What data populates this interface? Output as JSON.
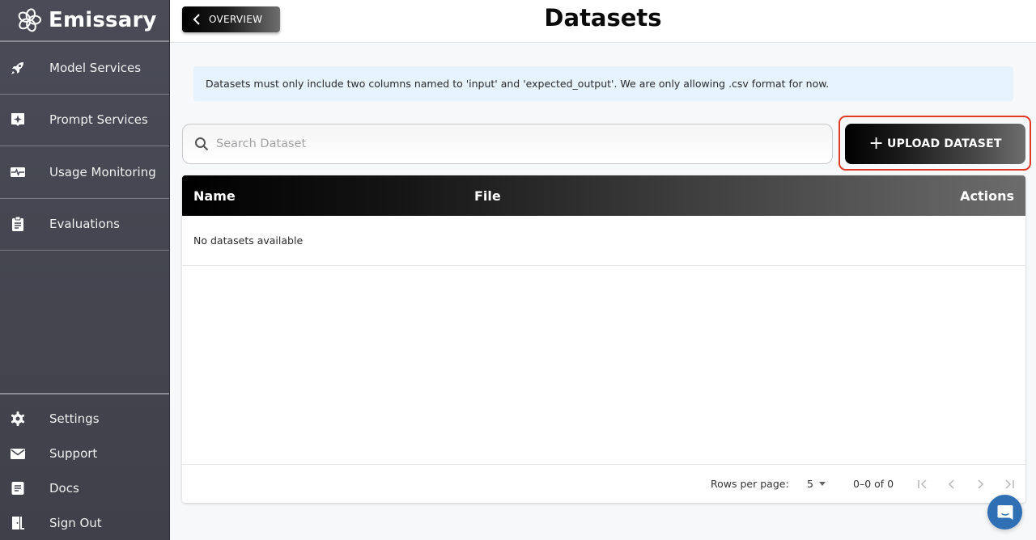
{
  "app": {
    "name": "Emissary"
  },
  "sidebar": {
    "items": [
      {
        "label": "Model Services",
        "icon": "rocket-icon"
      },
      {
        "label": "Prompt Services",
        "icon": "sparkle-chat-icon"
      },
      {
        "label": "Usage Monitoring",
        "icon": "pulse-monitor-icon"
      },
      {
        "label": "Evaluations",
        "icon": "clipboard-icon"
      }
    ],
    "bottom_items": [
      {
        "label": "Settings",
        "icon": "gear-icon"
      },
      {
        "label": "Support",
        "icon": "envelope-icon"
      },
      {
        "label": "Docs",
        "icon": "document-icon"
      },
      {
        "label": "Sign Out",
        "icon": "door-exit-icon"
      }
    ]
  },
  "header": {
    "back_label": "OVERVIEW",
    "title": "Datasets"
  },
  "info_banner": "Datasets must only include two columns named to 'input' and 'expected_output'. We are only allowing .csv format for now.",
  "search": {
    "placeholder": "Search Dataset",
    "value": ""
  },
  "upload_button": {
    "label": "UPLOAD DATASET",
    "icon": "plus-icon"
  },
  "table": {
    "columns": [
      "Name",
      "File",
      "Actions"
    ],
    "rows": [],
    "empty_message": "No datasets available",
    "footer": {
      "rows_per_page_label": "Rows per page:",
      "rows_per_page_value": "5",
      "range": "0–0 of 0"
    }
  },
  "colors": {
    "sidebar_bg": "#4a4b57",
    "info_bg": "#e6f3fc",
    "highlight_outline": "#e03a2a",
    "chat_bubble": "#2f6fb3"
  }
}
